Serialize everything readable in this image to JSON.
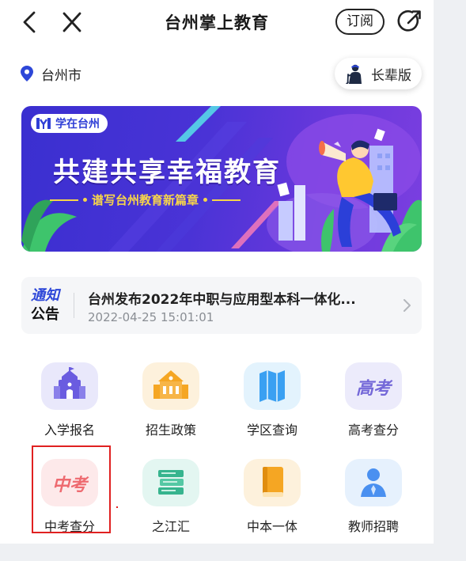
{
  "header": {
    "title": "台州掌上教育",
    "subscribe_label": "订阅"
  },
  "location": {
    "city": "台州市"
  },
  "elder_mode": {
    "label": "长辈版"
  },
  "banner": {
    "brand": "学在台州",
    "headline": "共建共享幸福教育",
    "subline": "谱写台州教育新篇章"
  },
  "notice": {
    "tag_line1": "通知",
    "tag_line2": "公告",
    "title": "台州发布2022年中职与应用型本科一体化...",
    "time": "2022-04-25 15:01:01"
  },
  "services": [
    {
      "label": "入学报名",
      "icon": "school-building-icon",
      "color": "#e9e8fb"
    },
    {
      "label": "招生政策",
      "icon": "school-policy-icon",
      "color": "#fdf1dc"
    },
    {
      "label": "学区查询",
      "icon": "map-icon",
      "color": "#e3f3fd"
    },
    {
      "label": "高考查分",
      "icon": "gaokao-icon",
      "color": "#ecebfb"
    },
    {
      "label": "中考查分",
      "icon": "zhongkao-icon",
      "icon_text": "中考",
      "color": "#fde9ea"
    },
    {
      "label": "之江汇",
      "icon": "books-icon",
      "color": "#e3f6f1"
    },
    {
      "label": "中本一体",
      "icon": "book-icon",
      "color": "#fdf1dc"
    },
    {
      "label": "教师招聘",
      "icon": "teacher-icon",
      "color": "#e6f1fd"
    }
  ],
  "gaokao_icon_text": "高考",
  "colors": {
    "accent_blue": "#2d47d8",
    "highlight_red": "#e02121",
    "banner_gold": "#f7d54a"
  }
}
